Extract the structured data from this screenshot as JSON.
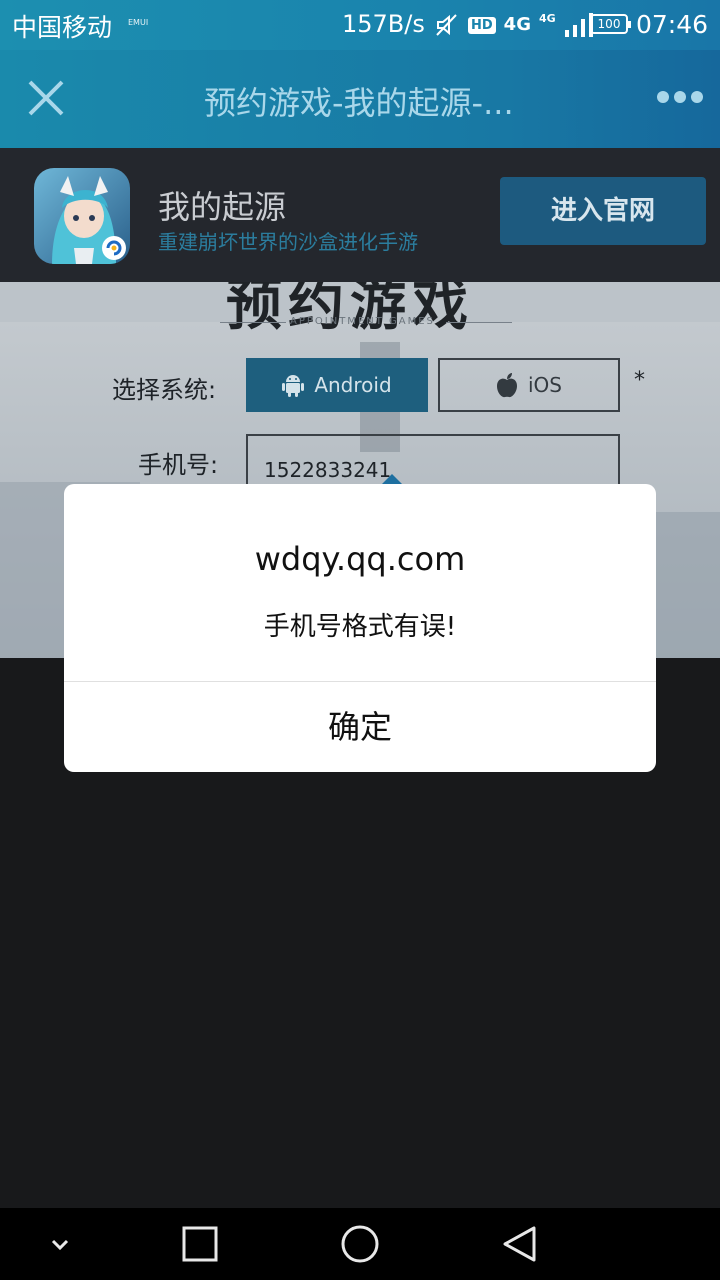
{
  "status_bar": {
    "carrier": "中国移动",
    "emui": "EMUI",
    "speed": "157B/s",
    "hd": "HD",
    "network": "4G",
    "network_small": "4G",
    "battery": "100",
    "time": "07:46"
  },
  "title_bar": {
    "title": "预约游戏-我的起源-..."
  },
  "app_banner": {
    "name": "我的起源",
    "subtitle": "重建崩坏世界的沙盒进化手游",
    "official_button": "进入官网"
  },
  "form": {
    "headline": "预约游戏",
    "headline_sub": "APPOINTMENT GAMES",
    "system_label": "选择系统:",
    "android_label": "Android",
    "ios_label": "iOS",
    "required_mark": "*",
    "phone_label": "手机号:",
    "phone_value": "1522833241",
    "selected_system": "Android"
  },
  "dialog": {
    "domain": "wdqy.qq.com",
    "message": "手机号格式有误!",
    "ok_button": "确定"
  },
  "colors": {
    "accent": "#1d5a7f",
    "title_bar": "#1a84ad",
    "dark_bg": "#18191b"
  },
  "icons": [
    "close-icon",
    "more-icon",
    "android-icon",
    "apple-icon",
    "back-icon",
    "home-icon",
    "recents-icon",
    "collapse-icon"
  ]
}
